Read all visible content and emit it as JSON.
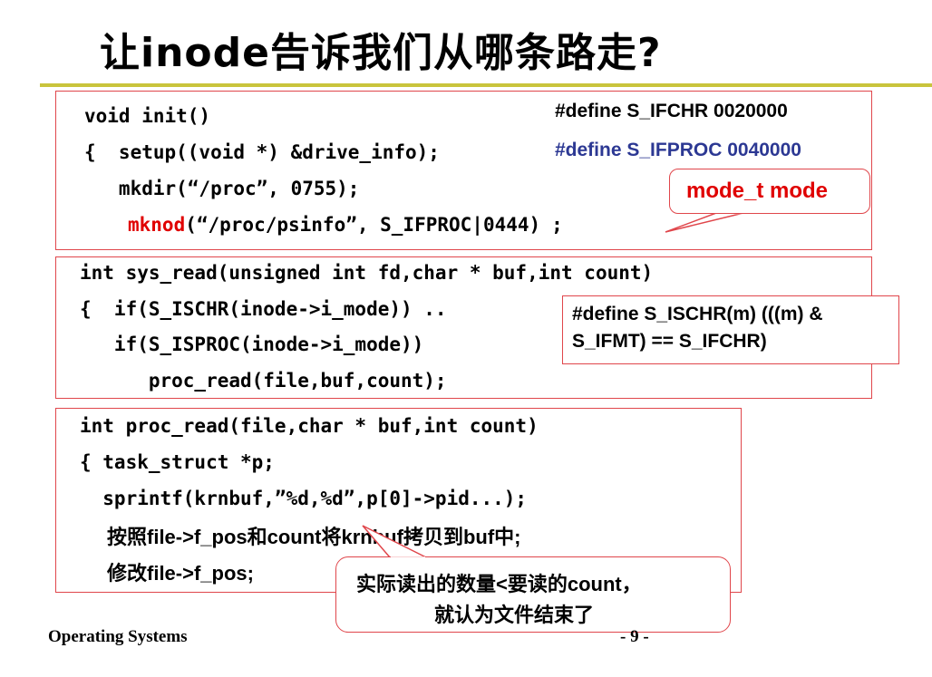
{
  "title": "让inode告诉我们从哪条路走?",
  "box1": {
    "lines": [
      "void init()",
      "{  setup((void *) &drive_info);",
      "   mkdir(“/proc”, 0755);",
      "(“/proc/psinfo”, S_IFPROC|0444)"
    ],
    "mknod": "mknod",
    "trailing": ";",
    "define1": "#define S_IFCHR  0020000",
    "define2": "#define S_IFPROC  0040000"
  },
  "callout_mode": "mode_t  mode",
  "box2": {
    "lines": [
      "int sys_read(unsigned int fd,char * buf,int count)",
      "{  if(S_ISCHR(inode->i_mode)) ..",
      "   if(S_ISPROC(inode->i_mode))",
      "      proc_read(file,buf,count);"
    ]
  },
  "callout_ischr": {
    "line1": "#define S_ISCHR(m)   (((m) &",
    "line2": "S_IFMT) == S_IFCHR)"
  },
  "box3": {
    "lines": [
      "int proc_read(file,char * buf,int count)",
      "{ task_struct *p;",
      "  sprintf(krnbuf,”%d,%d”,p[0]->pid...);"
    ],
    "cn1": "按照file->f_pos和count将krnbuf拷贝到buf中;",
    "cn2": "修改file->f_pos;"
  },
  "callout_eof": {
    "line1": "实际读出的数量<要读的count，",
    "line2": "就认为文件结束了"
  },
  "footer": {
    "left": "Operating Systems",
    "right": "- 9 -"
  },
  "colors": {
    "accent_rule": "#c9c43c",
    "box_border": "#e0464b",
    "highlight_red": "#e00000",
    "define_blue": "#2c3893"
  }
}
